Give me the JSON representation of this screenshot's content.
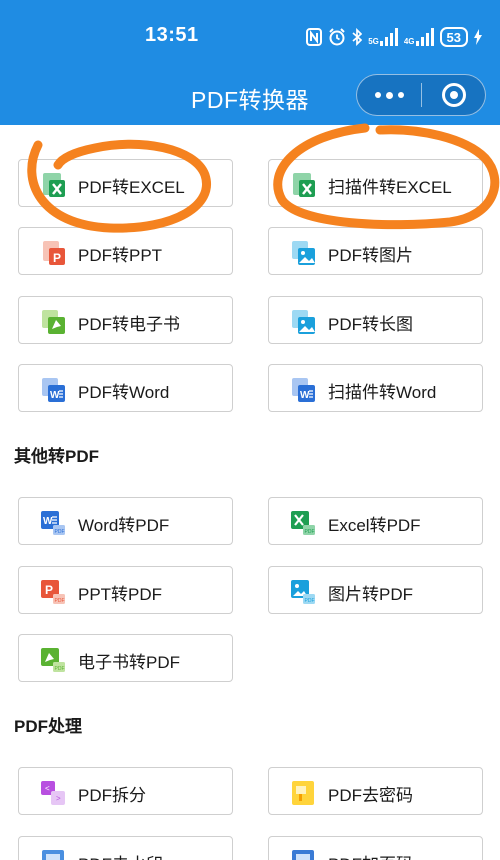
{
  "status_bar": {
    "time": "13:51",
    "net1": "5G",
    "net2": "4G",
    "battery": "53"
  },
  "header": {
    "title": "PDF转换器"
  },
  "sections": {
    "other_to_pdf": "其他转PDF",
    "pdf_tools": "PDF处理"
  },
  "tiles": [
    {
      "label": "PDF转EXCEL",
      "icon": "excel-icon"
    },
    {
      "label": "扫描件转EXCEL",
      "icon": "excel-icon"
    },
    {
      "label": "PDF转PPT",
      "icon": "ppt-icon"
    },
    {
      "label": "PDF转图片",
      "icon": "image-icon"
    },
    {
      "label": "PDF转电子书",
      "icon": "ebook-icon"
    },
    {
      "label": "PDF转长图",
      "icon": "image-icon"
    },
    {
      "label": "PDF转Word",
      "icon": "word-icon"
    },
    {
      "label": "扫描件转Word",
      "icon": "word-icon"
    },
    {
      "label": "Word转PDF",
      "icon": "word-pdf-icon"
    },
    {
      "label": "Excel转PDF",
      "icon": "excel-pdf-icon"
    },
    {
      "label": "PPT转PDF",
      "icon": "ppt-pdf-icon"
    },
    {
      "label": "图片转PDF",
      "icon": "image-pdf-icon"
    },
    {
      "label": "电子书转PDF",
      "icon": "ebook-pdf-icon"
    },
    {
      "label": "PDF拆分",
      "icon": "split-icon"
    },
    {
      "label": "PDF去密码",
      "icon": "unlock-icon"
    },
    {
      "label": "PDF去水印",
      "icon": "watermark-icon"
    },
    {
      "label": "PDF加页码",
      "icon": "page-number-icon"
    }
  ],
  "colors": {
    "header_bg": "#1f8ce3",
    "annotation": "#f5821f",
    "excel": "#1e9e52",
    "word": "#2a6fd6",
    "ppt": "#e8563a",
    "image": "#1aa0dc",
    "ebook": "#5ab232"
  }
}
